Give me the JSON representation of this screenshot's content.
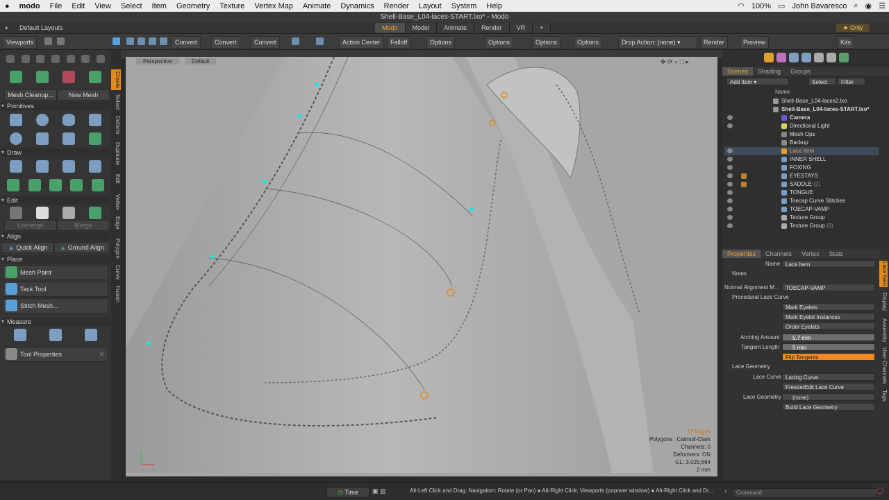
{
  "macbar": {
    "app": "modo",
    "menus": [
      "File",
      "Edit",
      "View",
      "Select",
      "Item",
      "Geometry",
      "Texture",
      "Vertex Map",
      "Animate",
      "Dynamics",
      "Render",
      "Layout",
      "System",
      "Help"
    ],
    "battery": "100%",
    "user": "John Bavaresco"
  },
  "window_title": "Shell-Base_L04-laces-START.lxo* - Modo",
  "layoutbar": {
    "label": "Default Layouts",
    "tabs": [
      "Modo",
      "Model",
      "Animate",
      "Render",
      "VR"
    ],
    "active_tab": "Modo",
    "only": "Only"
  },
  "toolbar": {
    "viewports": "Viewports",
    "convert1": "Convert",
    "convert2": "Convert",
    "convert3": "Convert",
    "action_center": "Action Center",
    "falloff": "Falloff",
    "options1": "Options",
    "options2": "Options",
    "options3": "Options",
    "options4": "Options",
    "drop_action": "Drop Action: (none)",
    "render": "Render",
    "preview": "Preview",
    "kits": "Kits"
  },
  "leftpanel": {
    "mesh_cleanup": "Mesh Cleanup...",
    "new_mesh": "New Mesh",
    "primitives": "Primitives",
    "draw": "Draw",
    "edit": "Edit",
    "unmerge": "Unmerge",
    "merge": "Merge",
    "align": "Align",
    "quick_align": "Quick Align",
    "ground_align": "Ground Align",
    "place": "Place",
    "mesh_paint": "Mesh Paint",
    "tack_tool": "Tack Tool",
    "stitch_mesh": "Stitch Mesh...",
    "measure": "Measure",
    "tool_properties": "Tool Properties",
    "tool_properties_key": "K",
    "vtabs": [
      "Create",
      "Select",
      "Deform",
      "Duplicate",
      "Edit",
      "Vertex",
      "Edge",
      "Polygon",
      "Curve",
      "Fusion"
    ]
  },
  "viewport": {
    "view": "Perspective",
    "style": "Default",
    "stats": {
      "edges": "52 Edges",
      "polygons": "Polygons : Catmull-Clark",
      "channels": "Channels: 0",
      "deformers": "Deformers: ON",
      "gl": "GL: 3,025,664",
      "scale": "2 mm"
    }
  },
  "scene": {
    "tabs": [
      "Scenes",
      "Shading",
      "Groups"
    ],
    "add_item": "Add Item",
    "select": "Select",
    "filter": "Filter",
    "col_name": "Name",
    "items": [
      {
        "name": "Shell-Base_L04-laces2.lxo",
        "count": ""
      },
      {
        "name": "Shell-Base_L04-laces-START.lxo*",
        "count": ""
      },
      {
        "name": "Camera",
        "count": ""
      },
      {
        "name": "Directional Light",
        "count": ""
      },
      {
        "name": "Mesh Ops",
        "count": ""
      },
      {
        "name": "Backup",
        "count": ""
      },
      {
        "name": "Lace Item",
        "count": ""
      },
      {
        "name": "INNER SHELL",
        "count": ""
      },
      {
        "name": "FOXING",
        "count": ""
      },
      {
        "name": "EYESTAYS",
        "count": ""
      },
      {
        "name": "SADDLE",
        "count": "(2)"
      },
      {
        "name": "TONGUE",
        "count": ""
      },
      {
        "name": "Toecap Curve Stitches",
        "count": ""
      },
      {
        "name": "TOECAP-VAMP",
        "count": ""
      },
      {
        "name": "Texture Group",
        "count": ""
      },
      {
        "name": "Texture Group",
        "count": "(6)"
      }
    ]
  },
  "properties": {
    "tabs": [
      "Properties",
      "Channels",
      "Vertex",
      "Stats"
    ],
    "name_label": "Name",
    "name_value": "Lace Item",
    "notes": "Notes",
    "normal_alignment_label": "Normal Alignment M...",
    "normal_alignment_value": "TOECAP-VAMP",
    "procedural_lace_curve": "Procedural Lace Curve",
    "mark_eyelets": "Mark Eyelets",
    "mark_eyelet_instances": "Mark Eyelet Instances",
    "order_eyelets": "Order Eyelets",
    "arching_label": "Arching Amount",
    "arching_value": "5.7 mm",
    "tangent_label": "Tangent Length",
    "tangent_value": "5 mm",
    "flip_tangents": "Flip Tangents",
    "lace_geometry": "Lace Geometry",
    "lace_curve_label": "Lace Curve",
    "lace_curve_value": "Lacing Curve",
    "freeze_edit": "Freeze/Edit Lace Curve",
    "lace_geometry_label": "Lace Geometry",
    "lace_geometry_value": "(none)",
    "build_lace_geometry": "Build Lace Geometry",
    "rvtabs": [
      "Lace Item",
      "Display",
      "Assembly",
      "User Channels",
      "Tags"
    ]
  },
  "statusbar": {
    "time": "Time",
    "hint": "Alt-Left Click and Drag: Navigation: Rotate (or Pan) ● Alt-Right Click: Viewports (popover window) ● Alt-Right Click and Dr...",
    "command_placeholder": "Command"
  },
  "colors": {
    "accent": "#f08a1e",
    "viewport_bg": "#a8a8a8",
    "selection": "#3f4a5a"
  }
}
